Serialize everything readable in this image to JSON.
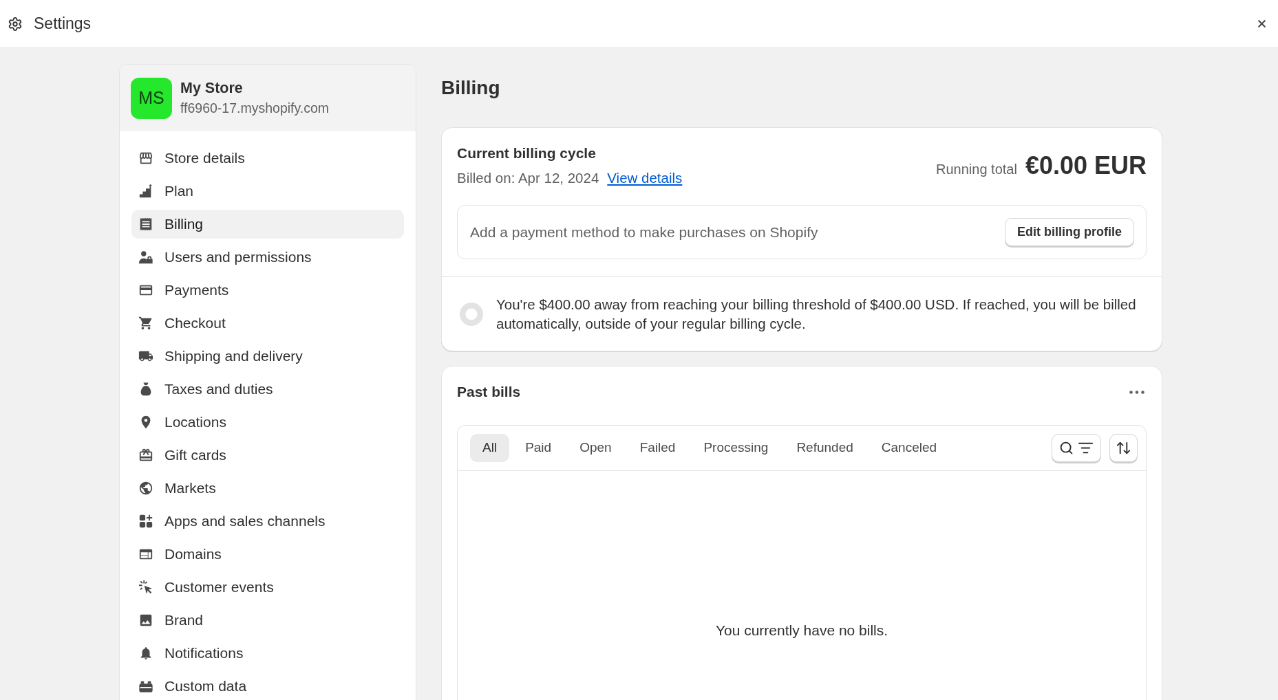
{
  "window": {
    "title": "Settings"
  },
  "sidebar": {
    "store": {
      "initials": "MS",
      "name": "My Store",
      "domain": "ff6960-17.myshopify.com"
    },
    "items": [
      {
        "label": "Store details",
        "selected": false
      },
      {
        "label": "Plan",
        "selected": false
      },
      {
        "label": "Billing",
        "selected": true
      },
      {
        "label": "Users and permissions",
        "selected": false
      },
      {
        "label": "Payments",
        "selected": false
      },
      {
        "label": "Checkout",
        "selected": false
      },
      {
        "label": "Shipping and delivery",
        "selected": false
      },
      {
        "label": "Taxes and duties",
        "selected": false
      },
      {
        "label": "Locations",
        "selected": false
      },
      {
        "label": "Gift cards",
        "selected": false
      },
      {
        "label": "Markets",
        "selected": false
      },
      {
        "label": "Apps and sales channels",
        "selected": false
      },
      {
        "label": "Domains",
        "selected": false
      },
      {
        "label": "Customer events",
        "selected": false
      },
      {
        "label": "Brand",
        "selected": false
      },
      {
        "label": "Notifications",
        "selected": false
      },
      {
        "label": "Custom data",
        "selected": false
      }
    ]
  },
  "page": {
    "title": "Billing"
  },
  "current_billing_cycle": {
    "title": "Current billing cycle",
    "billed_on": "Billed on: Apr 12, 2024",
    "link": "View details",
    "running_total_label": "Running total",
    "running_total": "€0.00 EUR",
    "payment_notice": "Add a payment method to make purchases on Shopify",
    "button": "Edit billing profile",
    "threshold": {
      "level": 0,
      "message": "You're $400.00 away from reaching your billing threshold of $400.00 USD. If reached, you will be billed automatically, outside of your regular billing cycle."
    }
  },
  "past_bills": {
    "title": "Past bills",
    "tabs": [
      {
        "label": "All",
        "selected": true
      },
      {
        "label": "Paid",
        "selected": false
      },
      {
        "label": "Open",
        "selected": false
      },
      {
        "label": "Failed",
        "selected": false
      },
      {
        "label": "Processing",
        "selected": false
      },
      {
        "label": "Refunded",
        "selected": false
      },
      {
        "label": "Canceled",
        "selected": false
      }
    ],
    "empty_message": "You currently have no bills."
  }
}
